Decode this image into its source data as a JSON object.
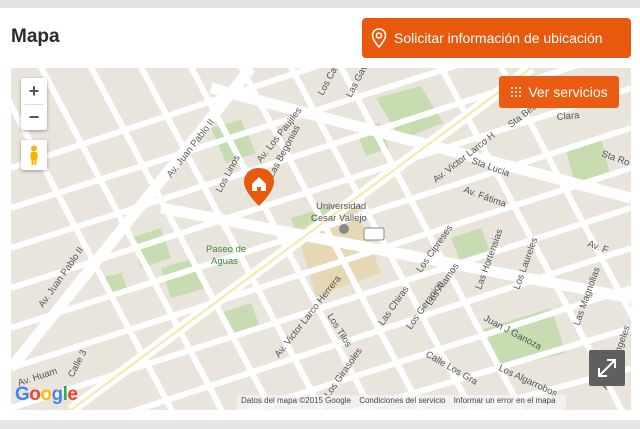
{
  "header": {
    "title": "Mapa",
    "request_button_label": "Solicitar información de ubicación"
  },
  "map": {
    "controls": {
      "zoom_in": "+",
      "zoom_out": "−",
      "services_button_label": "Ver servicios"
    },
    "logo": [
      "G",
      "o",
      "o",
      "g",
      "l",
      "e"
    ],
    "attribution": {
      "data": "Datos del mapa ©2015 Google",
      "terms": "Condiciones del servicio",
      "report": "Informar un error en el mapa"
    },
    "marker_icon": "home-marker-icon",
    "colors": {
      "accent": "#e8580d",
      "marker": "#e8580d",
      "park": "#c7dcb0",
      "road": "#ffffff",
      "block": "#e9e4dc"
    },
    "street_labels": [
      "Av. Juan Pablo II",
      "Av. Los Paujiles",
      "Los Linos",
      "Las Begonias",
      "Los Ca",
      "Las Gav",
      "Av. Victor Larco H",
      "Sta Bea",
      "Clara",
      "Sta Lucia",
      "Sta Ro",
      "Av. Fátima",
      "Universidad",
      "Cesar Vallejo",
      "773",
      "Paseo de",
      "Aguas",
      "Los Cipreses",
      "Los Alamos",
      "Las Hortensias",
      "Los Laureles",
      "Av. F",
      "Las Magnolias",
      "Los Geranios",
      "Las Chiras",
      "Av. Victor Larco Herrera",
      "Los Tilos",
      "Los Girasoles",
      "Juan J Ganoza",
      "Los Algarrobos",
      "Calle Los Gra",
      "Av. Juan Pablo II",
      "Calle 3",
      "Av. Huam",
      "Av. Los Angeles"
    ]
  }
}
